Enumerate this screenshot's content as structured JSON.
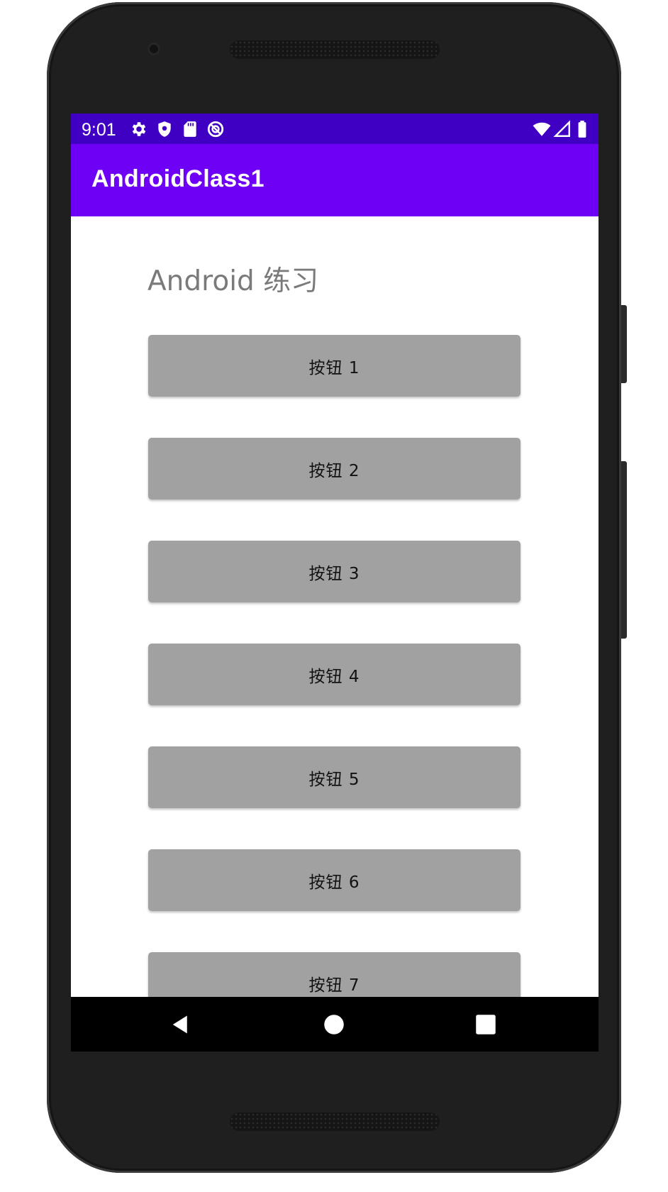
{
  "status_bar": {
    "time": "9:01",
    "left_icons": [
      "settings-icon",
      "shield-icon",
      "sd-card-icon",
      "do-not-disturb-icon"
    ],
    "right_icons": [
      "wifi-icon",
      "signal-icon",
      "battery-icon"
    ],
    "background": "#3f00c4"
  },
  "app_bar": {
    "title": "AndroidClass1",
    "background": "#6d00f5"
  },
  "main": {
    "heading": "Android 练习",
    "buttons": [
      {
        "label": "按钮 1"
      },
      {
        "label": "按钮 2"
      },
      {
        "label": "按钮 3"
      },
      {
        "label": "按钮 4"
      },
      {
        "label": "按钮 5"
      },
      {
        "label": "按钮 6"
      },
      {
        "label": "按钮 7"
      }
    ],
    "button_color": "#a1a1a1"
  },
  "nav_bar": {
    "icons": [
      "back-icon",
      "home-icon",
      "recents-icon"
    ]
  }
}
